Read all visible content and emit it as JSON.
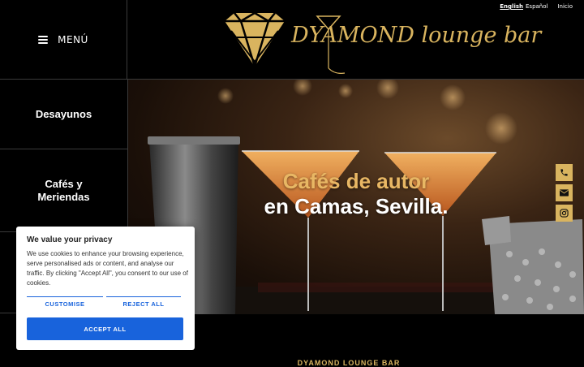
{
  "header": {
    "menu_label": "MENÚ",
    "logo_text": "DYAMOND lounge bar",
    "languages": [
      {
        "label": "English",
        "active": true
      },
      {
        "label": "Español",
        "active": false
      }
    ],
    "home_link": "Inicio"
  },
  "sidebar": {
    "items": [
      {
        "label": "Desayunos"
      },
      {
        "label": "Cafés y Meriendas"
      },
      {
        "label": ""
      },
      {
        "label": ""
      }
    ]
  },
  "hero": {
    "title_line1": "Cafés de autor",
    "title_line2": "en Camas, Sevilla."
  },
  "social": {
    "buttons": [
      "phone-icon",
      "mail-icon",
      "instagram-icon"
    ]
  },
  "footer": {
    "brand": "DYAMOND LOUNGE BAR"
  },
  "cookie_banner": {
    "title": "We value your privacy",
    "text": "We use cookies to enhance your browsing experience, serve personalised ads or content, and analyse our traffic. By clicking \"Accept All\", you consent to our use of cookies.",
    "customise_label": "CUSTOMISE",
    "reject_label": "REJECT ALL",
    "accept_label": "ACCEPT ALL"
  },
  "colors": {
    "gold": "#d9b45f",
    "hero_title_gold": "#e8b764",
    "background": "#000000",
    "cookie_accent": "#1863dc"
  }
}
